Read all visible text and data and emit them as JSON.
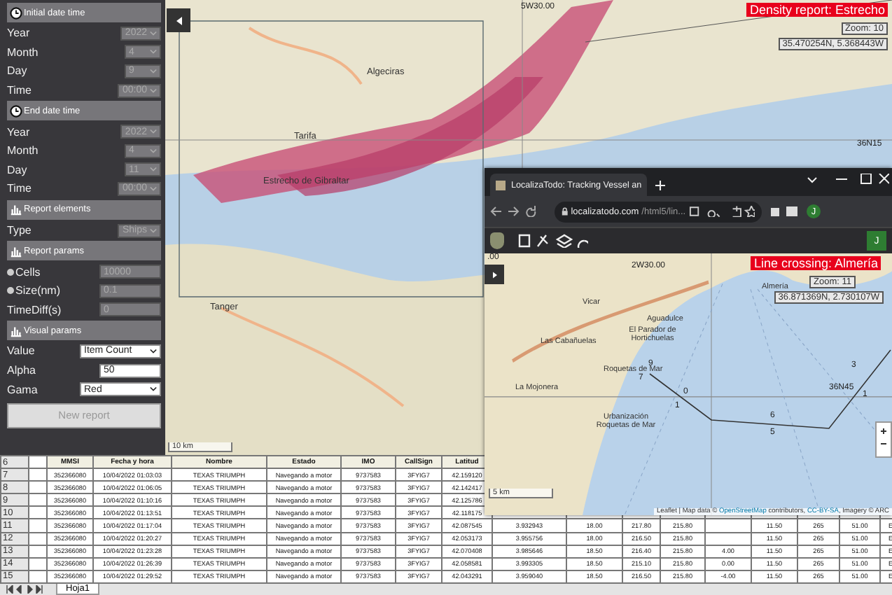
{
  "sidebar": {
    "items": [
      {
        "kind": "header",
        "label": "Initial date time"
      },
      {
        "kind": "select",
        "label": "Year",
        "value": "2022",
        "disabled": true
      },
      {
        "kind": "select",
        "label": "Month",
        "value": "4",
        "disabled": true
      },
      {
        "kind": "select",
        "label": "Day",
        "value": "9",
        "disabled": true
      },
      {
        "kind": "select",
        "label": "Time",
        "value": "00:00",
        "disabled": true
      },
      {
        "kind": "header",
        "label": "End date time"
      },
      {
        "kind": "select",
        "label": "Year",
        "value": "2022",
        "disabled": true
      },
      {
        "kind": "select",
        "label": "Month",
        "value": "4",
        "disabled": true
      },
      {
        "kind": "select",
        "label": "Day",
        "value": "11",
        "disabled": true
      },
      {
        "kind": "select",
        "label": "Time",
        "value": "00:00",
        "disabled": true
      },
      {
        "kind": "header",
        "label": "Report elements"
      },
      {
        "kind": "select",
        "label": "Type",
        "value": "Ships",
        "disabled": true
      },
      {
        "kind": "header",
        "label": "Report params"
      },
      {
        "kind": "input",
        "label": "Cells",
        "value": "10000",
        "disabled": true,
        "bullet": true
      },
      {
        "kind": "input",
        "label": "Size(nm)",
        "value": "0.1",
        "disabled": true,
        "bullet": true
      },
      {
        "kind": "input",
        "label": "TimeDiff(s)",
        "value": "0",
        "disabled": true,
        "bullet": false
      },
      {
        "kind": "header",
        "label": "Visual params"
      },
      {
        "kind": "select",
        "label": "Value",
        "value": "Item Count",
        "disabled": false
      },
      {
        "kind": "input",
        "label": "Alpha",
        "value": "50",
        "disabled": false,
        "bullet": false
      },
      {
        "kind": "select",
        "label": "Gama",
        "value": "Red",
        "disabled": false
      },
      {
        "kind": "button",
        "label": "New report"
      }
    ]
  },
  "map": {
    "badge": "Density report: Estrecho",
    "zoom": "Zoom: 10",
    "coords": "35.470254N, 5.368443W",
    "grid_labels": [
      "5W30.00",
      "36N15"
    ],
    "places": [
      "Algeciras",
      "Tarifa",
      "Estrecho de Gibraltar",
      "Tanger"
    ],
    "scale": "10 km"
  },
  "spreadsheet": {
    "header_row": "6",
    "columns": [
      "MMSI",
      "Fecha y hora",
      "Nombre",
      "Estado",
      "IMO",
      "CallSign",
      "Latitud"
    ],
    "rows": [
      {
        "num": "7",
        "cells": [
          "352366080",
          "10/04/2022 01:03:03",
          "TEXAS TRIUMPH",
          "Navegando a motor",
          "9737583",
          "3FYIG7",
          "42.159120"
        ]
      },
      {
        "num": "8",
        "cells": [
          "352366080",
          "10/04/2022 01:06:05",
          "TEXAS TRIUMPH",
          "Navegando a motor",
          "9737583",
          "3FYIG7",
          "42.142417"
        ]
      },
      {
        "num": "9",
        "cells": [
          "352366080",
          "10/04/2022 01:10:16",
          "TEXAS TRIUMPH",
          "Navegando a motor",
          "9737583",
          "3FYIG7",
          "42.125786"
        ]
      },
      {
        "num": "10",
        "cells": [
          "352366080",
          "10/04/2022 01:13:51",
          "TEXAS TRIUMPH",
          "Navegando a motor",
          "9737583",
          "3FYIG7",
          "42.118175"
        ]
      },
      {
        "num": "11",
        "cells": [
          "352366080",
          "10/04/2022 01:17:04",
          "TEXAS TRIUMPH",
          "Navegando a motor",
          "9737583",
          "3FYIG7",
          "42.087545",
          "3.932943",
          "18.00",
          "217.80",
          "215.80",
          "",
          "11.50",
          "265",
          "51.00",
          "E"
        ]
      },
      {
        "num": "12",
        "cells": [
          "352366080",
          "10/04/2022 01:20:27",
          "TEXAS TRIUMPH",
          "Navegando a motor",
          "9737583",
          "3FYIG7",
          "42.053173",
          "3.955756",
          "18.00",
          "216.50",
          "215.80",
          "",
          "11.50",
          "265",
          "51.00",
          "E"
        ]
      },
      {
        "num": "13",
        "cells": [
          "352366080",
          "10/04/2022 01:23:28",
          "TEXAS TRIUMPH",
          "Navegando a motor",
          "9737583",
          "3FYIG7",
          "42.070408",
          "3.985646",
          "18.50",
          "216.40",
          "215.80",
          "4.00",
          "11.50",
          "265",
          "51.00",
          "E"
        ]
      },
      {
        "num": "14",
        "cells": [
          "352366080",
          "10/04/2022 01:26:39",
          "TEXAS TRIUMPH",
          "Navegando a motor",
          "9737583",
          "3FYIG7",
          "42.058581",
          "3.993305",
          "18.50",
          "215.10",
          "215.80",
          "0.00",
          "11.50",
          "265",
          "51.00",
          "E"
        ]
      },
      {
        "num": "15",
        "cells": [
          "352366080",
          "10/04/2022 01:29:52",
          "TEXAS TRIUMPH",
          "Navegando a motor",
          "9737583",
          "3FYIG7",
          "42.043291",
          "3.959040",
          "18.50",
          "216.50",
          "215.80",
          "-4.00",
          "11.50",
          "265",
          "51.00",
          "E"
        ]
      }
    ],
    "sheet_tab": "Hoja1"
  },
  "browser": {
    "tab_title": "LocalizaTodo: Tracking Vessel an",
    "url_host": "localizatodo.com",
    "url_path": "/html5/lin...",
    "profile": "J",
    "app_user": "J",
    "map": {
      "badge": "Line crossing: Almería",
      "zoom": "Zoom: 11",
      "coords": "36.871369N, 2.730107W",
      "grid_labels": [
        "2W30.00",
        ".00",
        "36N45"
      ],
      "places": [
        "Almería",
        "Vicar",
        "Aguadulce",
        "Las Cabañuelas",
        "El Parador de Hortichuelas",
        "Roquetas de Mar",
        "La Mojonera",
        "Urbanización Roquetas de Mar"
      ],
      "track_labels": [
        "9",
        "7",
        "0",
        "1",
        "6",
        "5",
        "3",
        "1"
      ],
      "scale": "5 km",
      "attribution": {
        "prefix": "Leaflet | Map data © ",
        "osm": "OpenStreetMap",
        "mid": " contributors, ",
        "license": "CC-BY-SA",
        "suffix": ", Imagery © ARC"
      }
    }
  }
}
